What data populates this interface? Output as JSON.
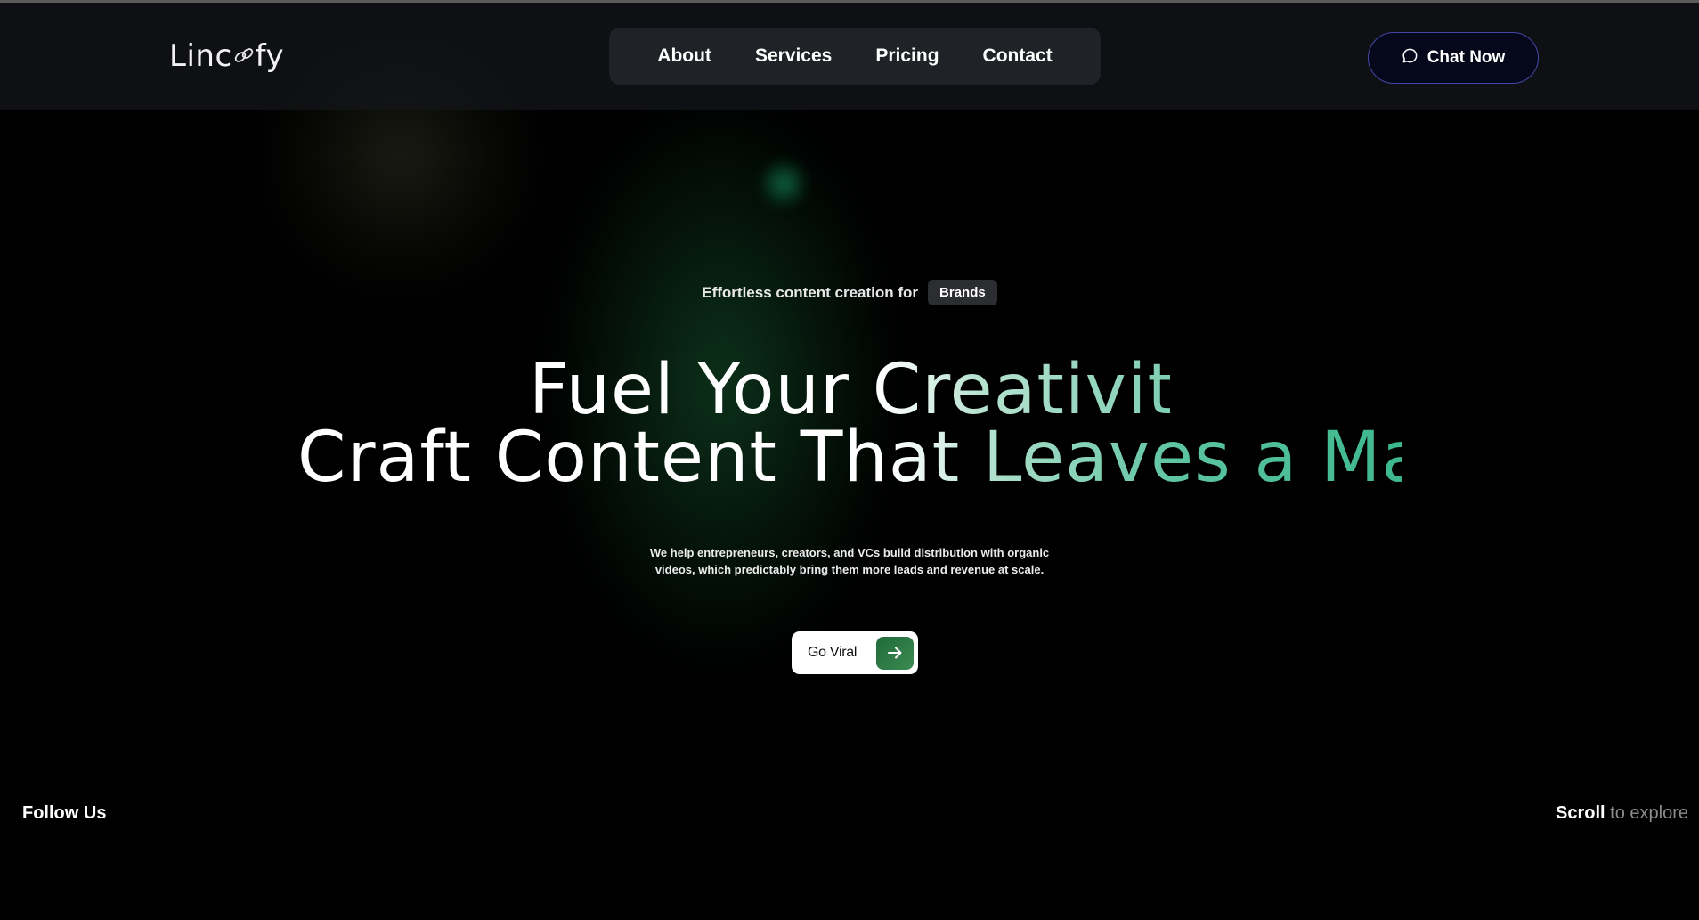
{
  "brand": {
    "name_start": "Linc",
    "name_end": "fy",
    "logo_glyph": "🔗"
  },
  "nav": {
    "items": [
      {
        "label": "About"
      },
      {
        "label": "Services"
      },
      {
        "label": "Pricing"
      },
      {
        "label": "Contact"
      }
    ]
  },
  "header": {
    "chat_label": "Chat Now"
  },
  "hero": {
    "tagline": "Effortless content creation for",
    "badge": "Brands",
    "title_line1": "Fuel Your Creativity",
    "title_line2": "Craft Content That Leaves a Mark!",
    "subtitle_line1": "We help entrepreneurs, creators, and VCs build distribution with organic",
    "subtitle_line2": "videos, which predictably bring them more leads and revenue at scale.",
    "cta_label": "Go Viral"
  },
  "footer": {
    "follow": "Follow Us",
    "scroll_word1": "Scroll",
    "scroll_word2": "to explore"
  },
  "colors": {
    "accent_green": "#3db88d",
    "cta_green": "#1f6b3a",
    "chat_border": "#4447a8"
  },
  "icons": {
    "chat": "chat-bubble-icon",
    "cta": "arrow-right-icon",
    "logo": "link-chain-icon"
  }
}
